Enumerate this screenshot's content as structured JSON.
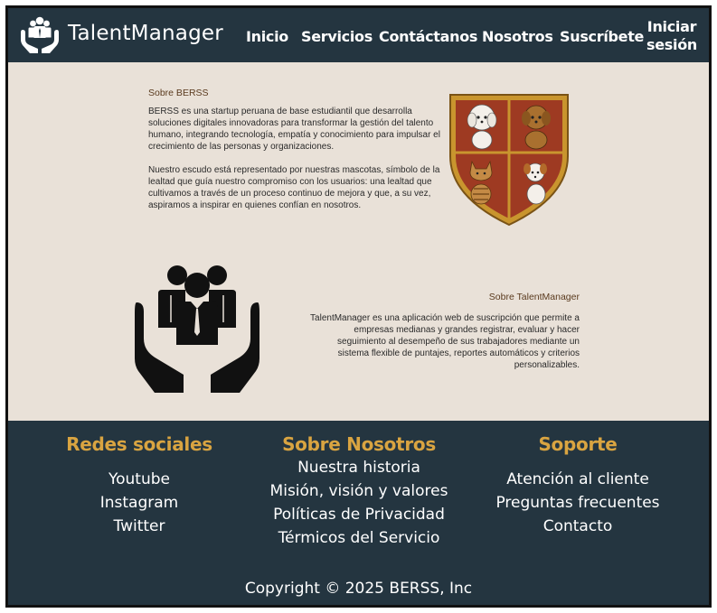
{
  "header": {
    "brand": "TalentManager",
    "nav": [
      "Inicio",
      "Servicios",
      "Contáctanos",
      "Nosotros",
      "Suscríbete"
    ],
    "login_line1": "Iniciar",
    "login_line2": "sesión"
  },
  "about": {
    "title": "Sobre BERSS",
    "paragraph1": "BERSS es una startup peruana de base estudiantil que desarrolla  soluciones digitales innovadoras para transformar la gestión del talento humano, integrando tecnología, empatía y conocimiento para impulsar el  crecimiento de las personas y organizaciones.",
    "paragraph2": "Nuestro escudo está representado por nuestras mascotas, símbolo de la lealtad que guía nuestro compromiso con los usuarios: una lealtad que cultivamos a través de un proceso continuo de mejora y que, a su vez, aspiramos a inspirar en quienes confían en nosotros."
  },
  "product": {
    "title": "Sobre TalentManager",
    "paragraph": "TalentManager es una aplicación web de suscripción que permite a  empresas medianas y grandes registrar, evaluar y hacer seguimiento al  desempeño de sus trabajadores mediante un sistema flexible de puntajes,  reportes automáticos y criterios personalizables."
  },
  "footer": {
    "social": {
      "title": "Redes sociales",
      "links": [
        "Youtube",
        "Instagram",
        "Twitter"
      ]
    },
    "about": {
      "title": "Sobre Nosotros",
      "links": [
        "Nuestra historia",
        "Misión, visión y valores",
        "Políticas de Privacidad",
        "Térmicos del Servicio"
      ]
    },
    "support": {
      "title": "Soporte",
      "links": [
        "Atención al cliente",
        "Preguntas frecuentes",
        "Contacto"
      ]
    },
    "copyright": "Copyright © 2025 BERSS, Inc"
  },
  "colors": {
    "navy": "#243540",
    "beige": "#e9e1d8",
    "gold": "#d9a441",
    "crest_red": "#9e3a22"
  },
  "icons": [
    "people-in-hands-icon",
    "shield-crest-icon"
  ]
}
